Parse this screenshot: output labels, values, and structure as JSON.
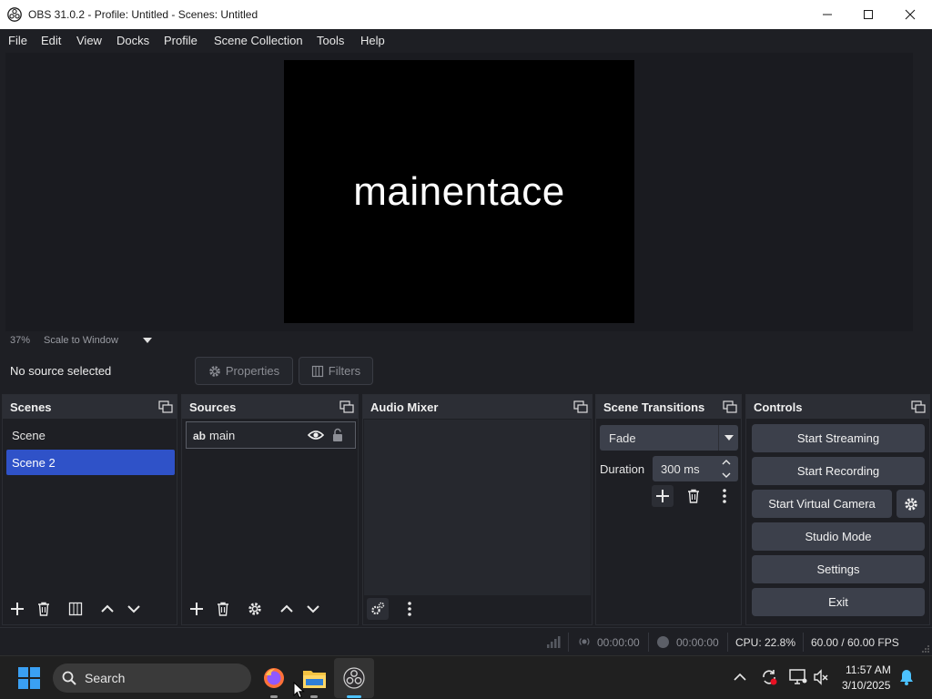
{
  "window": {
    "title": "OBS 31.0.2 - Profile: Untitled - Scenes: Untitled"
  },
  "menu": [
    "File",
    "Edit",
    "View",
    "Docks",
    "Profile",
    "Scene Collection",
    "Tools",
    "Help"
  ],
  "preview": {
    "text": "mainentace",
    "zoom": "37%",
    "scale_mode": "Scale to Window"
  },
  "context": {
    "selection": "No source selected",
    "properties_label": "Properties",
    "filters_label": "Filters"
  },
  "scenes": {
    "title": "Scenes",
    "items": [
      "Scene",
      "Scene 2"
    ],
    "selected": "Scene 2"
  },
  "sources": {
    "title": "Sources",
    "items": [
      {
        "type_icon": "ab",
        "name": "main"
      }
    ]
  },
  "audio_mixer": {
    "title": "Audio Mixer"
  },
  "transitions": {
    "title": "Scene Transitions",
    "selected": "Fade",
    "duration_label": "Duration",
    "duration_value": "300 ms"
  },
  "controls": {
    "title": "Controls",
    "start_streaming": "Start Streaming",
    "start_recording": "Start Recording",
    "start_virtual_camera": "Start Virtual Camera",
    "studio_mode": "Studio Mode",
    "settings": "Settings",
    "exit": "Exit"
  },
  "status": {
    "stream_time": "00:00:00",
    "record_time": "00:00:00",
    "cpu": "CPU: 22.8%",
    "fps": "60.00 / 60.00 FPS"
  },
  "taskbar": {
    "search_label": "Search",
    "time": "11:57 AM",
    "date": "3/10/2025"
  },
  "colors": {
    "selection_blue": "#2f52c8",
    "button_bg": "#3c404b",
    "panel_bg": "#1e1f24",
    "dock_header": "#2c2e35"
  }
}
